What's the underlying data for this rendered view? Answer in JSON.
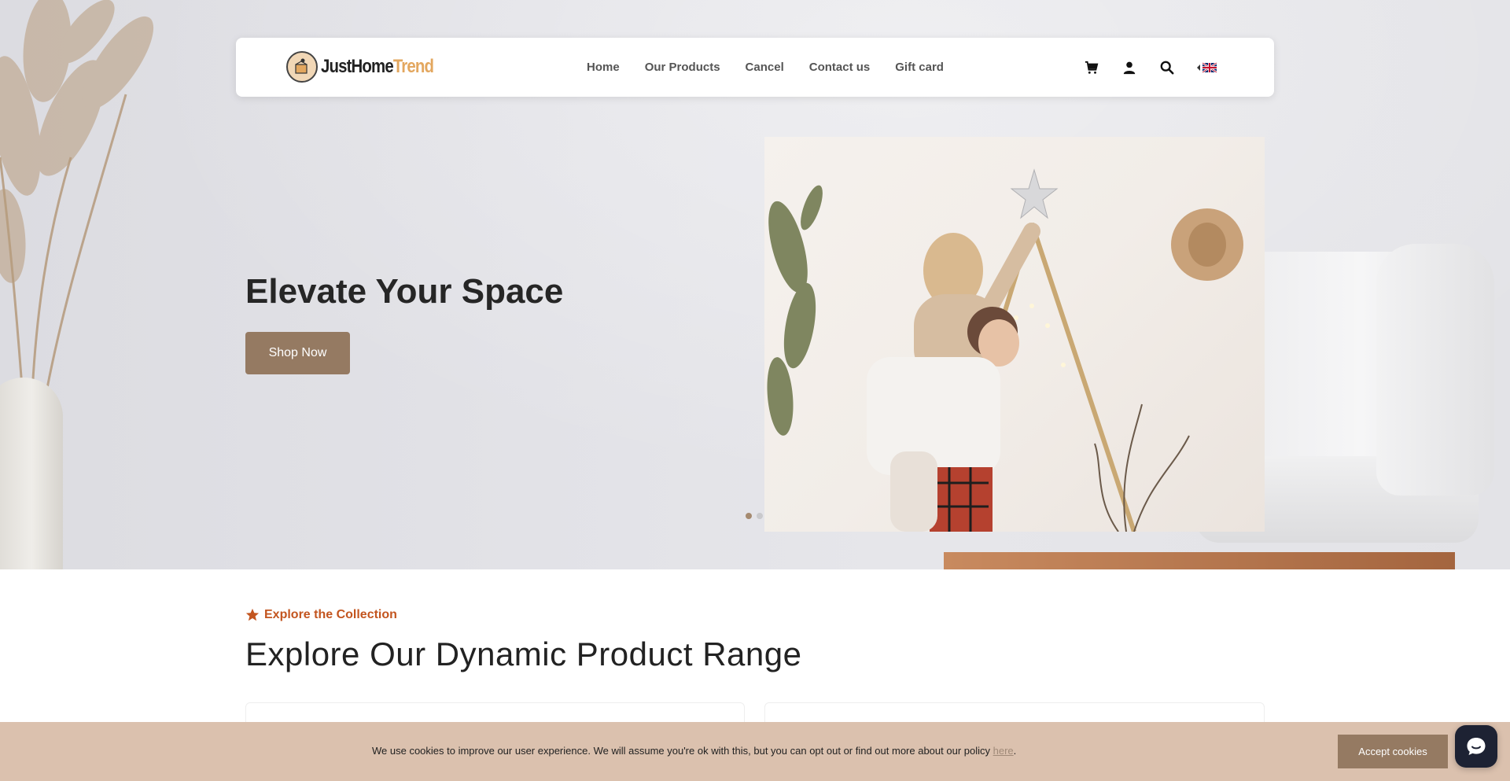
{
  "brand": {
    "logo_text_part1": "JustHome",
    "logo_text_part2": "Trend",
    "accent_color": "#e3a75f",
    "button_color": "#957a62"
  },
  "nav": {
    "links": [
      {
        "label": "Home"
      },
      {
        "label": "Our Products"
      },
      {
        "label": "Cancel"
      },
      {
        "label": "Contact us"
      },
      {
        "label": "Gift card"
      }
    ],
    "icons": [
      "cart-icon",
      "user-icon",
      "search-icon",
      "uk-flag-icon"
    ]
  },
  "hero": {
    "title": "Elevate Your Space",
    "cta_label": "Shop Now",
    "slides_count": 2,
    "active_slide": 1
  },
  "collection": {
    "eyebrow": "Explore the Collection",
    "eyebrow_color": "#c3551f",
    "title": "Explore Our Dynamic Product Range"
  },
  "cookie": {
    "text": "We use cookies to improve our user experience. We will assume you're ok with this, but you can opt out or find out more about our policy ",
    "link_label": "here",
    "suffix": ".",
    "accept_label": "Accept cookies",
    "bar_color": "#dbc1ae"
  },
  "chat": {
    "icon": "chat-icon"
  }
}
